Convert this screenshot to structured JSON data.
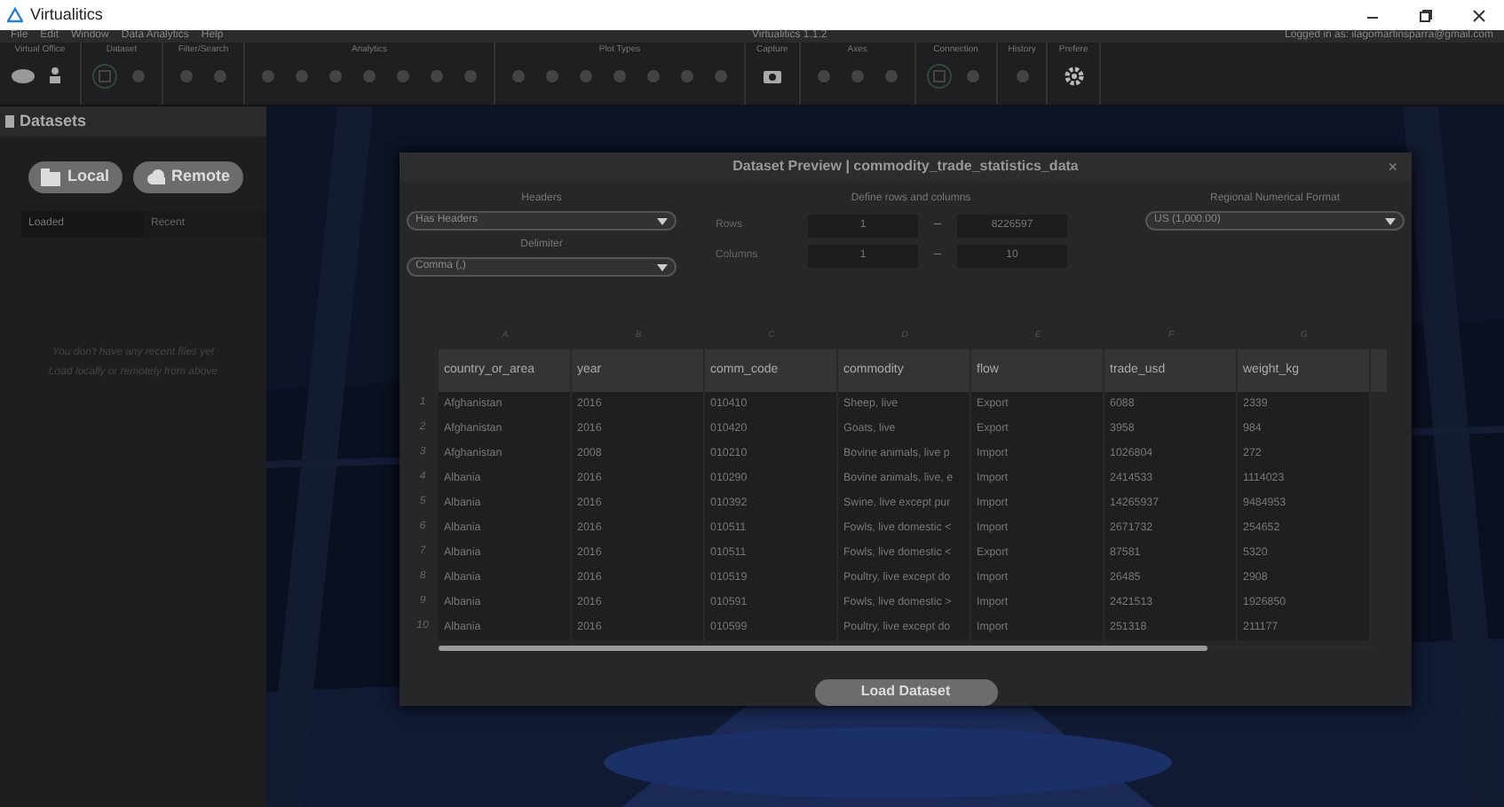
{
  "window": {
    "title": "Virtualitics"
  },
  "menu": [
    "File",
    "Edit",
    "Window",
    "Data Analytics",
    "Help"
  ],
  "app_version": "Virtualitics 1.1.2",
  "login": "Logged in as: ilagomartinsparra@gmail.com",
  "toolbar_groups": [
    "Virtual Office",
    "Dataset",
    "Filter/Search",
    "Analytics",
    "Plot Types",
    "Capture",
    "Axes",
    "Connection",
    "History",
    "Prefere"
  ],
  "sidebar": {
    "title": "Datasets",
    "buttons": [
      "Local",
      "Remote"
    ],
    "tabs": [
      {
        "label": "Loaded",
        "selected": true
      },
      {
        "label": "Recent",
        "selected": false
      }
    ],
    "empty_message": [
      "You don't have any recent files yet",
      "Load locally or remotely from above"
    ]
  },
  "dialog": {
    "title": "Dataset Preview | commodity_trade_statistics_data",
    "headers_label": "Headers",
    "headers_value": "Has Headers",
    "delimiter_label": "Delimiter",
    "delimiter_value": "Comma (,)",
    "range_label": "Define rows and columns",
    "rows_label": "Rows",
    "rows_from": "1",
    "rows_to": "8226597",
    "columns_label": "Columns",
    "columns_from": "1",
    "columns_to": "10",
    "range_dash": "–",
    "format_label": "Regional Numerical Format",
    "format_value": "US (1,000.00)",
    "table": {
      "letters": [
        "A",
        "B",
        "C",
        "D",
        "E",
        "F",
        "G"
      ],
      "columns": [
        "country_or_area",
        "year",
        "comm_code",
        "commodity",
        "flow",
        "trade_usd",
        "weight_kg"
      ],
      "rows": [
        {
          "n": "1",
          "cells": [
            "Afghanistan",
            "2016",
            "010410",
            "Sheep, live",
            "Export",
            "6088",
            "2339"
          ]
        },
        {
          "n": "2",
          "cells": [
            "Afghanistan",
            "2016",
            "010420",
            "Goats, live",
            "Export",
            "3958",
            "984"
          ]
        },
        {
          "n": "3",
          "cells": [
            "Afghanistan",
            "2008",
            "010210",
            "Bovine animals, live p",
            "Import",
            "1026804",
            "272"
          ]
        },
        {
          "n": "4",
          "cells": [
            "Albania",
            "2016",
            "010290",
            "Bovine animals, live, e",
            "Import",
            "2414533",
            "1114023"
          ]
        },
        {
          "n": "5",
          "cells": [
            "Albania",
            "2016",
            "010392",
            "Swine, live except pur",
            "Import",
            "14265937",
            "9484953"
          ]
        },
        {
          "n": "6",
          "cells": [
            "Albania",
            "2016",
            "010511",
            "Fowls, live domestic <",
            "Import",
            "2671732",
            "254652"
          ]
        },
        {
          "n": "7",
          "cells": [
            "Albania",
            "2016",
            "010511",
            "Fowls, live domestic <",
            "Export",
            "87581",
            "5320"
          ]
        },
        {
          "n": "8",
          "cells": [
            "Albania",
            "2016",
            "010519",
            "Poultry, live except do",
            "Import",
            "26485",
            "2908"
          ]
        },
        {
          "n": "9",
          "cells": [
            "Albania",
            "2016",
            "010591",
            "Fowls, live domestic >",
            "Import",
            "2421513",
            "1926850"
          ]
        },
        {
          "n": "10",
          "cells": [
            "Albania",
            "2016",
            "010599",
            "Poultry, live except do",
            "Import",
            "251318",
            "211177"
          ]
        }
      ]
    },
    "button": "Load Dataset",
    "close": "×"
  }
}
